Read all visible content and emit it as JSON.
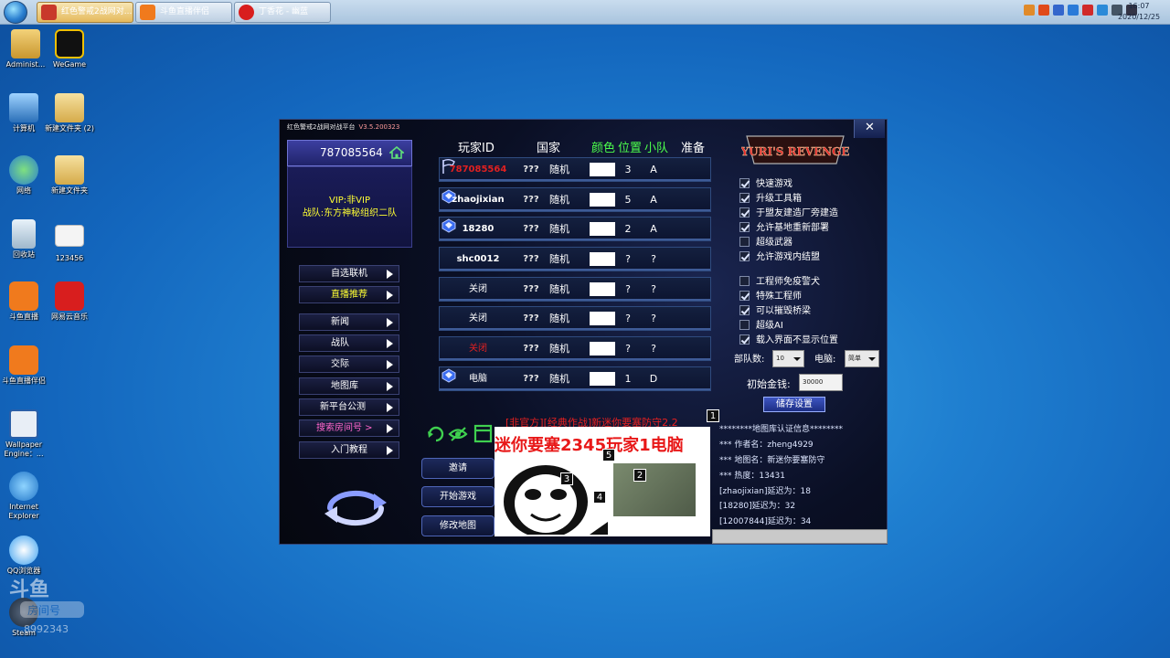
{
  "taskbar": {
    "tasks": [
      {
        "label": "红色警戒2战网对...",
        "active": true
      },
      {
        "label": "斗鱼直播伴侣",
        "active": false
      },
      {
        "label": "丁香花 - 幽蓝",
        "active": false
      }
    ],
    "clock_time": "16:07",
    "clock_date": "2020/12/25"
  },
  "desktop": {
    "icons": [
      {
        "label": "Administ...",
        "name": "administrator-folder-icon"
      },
      {
        "label": "WeGame",
        "name": "wegame-icon"
      },
      {
        "label": "计算机",
        "name": "computer-icon"
      },
      {
        "label": "新建文件夹 (2)",
        "name": "folder-icon"
      },
      {
        "label": "网络",
        "name": "network-icon"
      },
      {
        "label": "新建文件夹",
        "name": "folder-icon"
      },
      {
        "label": "回收站",
        "name": "recycle-bin-icon"
      },
      {
        "label": "123456",
        "name": "file-icon"
      },
      {
        "label": "斗鱼直播",
        "name": "douyu-icon"
      },
      {
        "label": "网易云音乐",
        "name": "netease-music-icon"
      },
      {
        "label": "斗鱼直播伴侣",
        "name": "douyu-companion-icon"
      },
      {
        "label": "Wallpaper Engine：...",
        "name": "wallpaper-engine-icon"
      },
      {
        "label": "Internet Explorer",
        "name": "ie-icon"
      },
      {
        "label": "QQ浏览器",
        "name": "qq-browser-icon"
      },
      {
        "label": "Steam",
        "name": "steam-icon"
      }
    ]
  },
  "watermark": {
    "room_label": "房间号",
    "room_number": "8992343"
  },
  "app": {
    "title": "红色警戒2战网对战平台",
    "version": "V3.5.200323",
    "close": "✕",
    "user_id": "787085564",
    "vip_line": "VIP:非VIP",
    "team_line": "战队:东方神秘组织二队",
    "menu": [
      {
        "label": "自选联机",
        "color": "#ffffff"
      },
      {
        "label": "直播推荐",
        "color": "#ffff33"
      },
      {
        "label": "新闻",
        "color": "#ffffff"
      },
      {
        "label": "战队",
        "color": "#ffffff"
      },
      {
        "label": "交际",
        "color": "#ffffff"
      },
      {
        "label": "地图库",
        "color": "#ffffff"
      },
      {
        "label": "新平台公测",
        "color": "#ffffff"
      },
      {
        "label": "搜索房间号 >",
        "color": "#ff66cc"
      },
      {
        "label": "入门教程",
        "color": "#ffffff"
      }
    ],
    "headers": {
      "player_id": "玩家ID",
      "country": "国家",
      "color": "颜色",
      "position": "位置",
      "team": "小队",
      "ready": "准备"
    },
    "rows": [
      {
        "id": "787085564",
        "id_color": "red",
        "flag": "???",
        "country": "随机",
        "pos": "3",
        "team": "A",
        "ready": "flag"
      },
      {
        "id": "zhaojixian",
        "id_color": "white",
        "flag": "???",
        "country": "随机",
        "pos": "5",
        "team": "A",
        "ready": "gem"
      },
      {
        "id": "18280",
        "id_color": "white",
        "flag": "???",
        "country": "随机",
        "pos": "2",
        "team": "A",
        "ready": "gem"
      },
      {
        "id": "shc0012",
        "id_color": "white",
        "flag": "???",
        "country": "随机",
        "pos": "?",
        "team": "?",
        "ready": ""
      },
      {
        "id": "关闭",
        "id_color": "white",
        "flag": "???",
        "country": "随机",
        "pos": "?",
        "team": "?",
        "ready": ""
      },
      {
        "id": "关闭",
        "id_color": "white",
        "flag": "???",
        "country": "随机",
        "pos": "?",
        "team": "?",
        "ready": ""
      },
      {
        "id": "关闭",
        "id_color": "red",
        "flag": "???",
        "country": "随机",
        "pos": "?",
        "team": "?",
        "ready": ""
      },
      {
        "id": "电脑",
        "id_color": "white",
        "flag": "???",
        "country": "随机",
        "pos": "1",
        "team": "D",
        "ready": "gem"
      }
    ],
    "map_title": "[非官方][经典作战]新迷你要塞防守2.2",
    "map_banner": "迷你要塞2345玩家1电脑",
    "map_tags": [
      "1",
      "5",
      "3",
      "2",
      "4"
    ],
    "buttons": {
      "invite": "邀请",
      "start": "开始游戏",
      "modify_map": "修改地图"
    },
    "logo_text": "YURI'S REVENGE",
    "options_a": [
      {
        "label": "快速游戏",
        "checked": true
      },
      {
        "label": "升级工具箱",
        "checked": true
      },
      {
        "label": "于盟友建造厂旁建造",
        "checked": true
      },
      {
        "label": "允许基地重新部署",
        "checked": true
      },
      {
        "label": "超级武器",
        "checked": false
      },
      {
        "label": "允许游戏内结盟",
        "checked": true
      }
    ],
    "options_b": [
      {
        "label": "工程师免疫警犬",
        "checked": false
      },
      {
        "label": "特殊工程师",
        "checked": true
      },
      {
        "label": "可以摧毁桥梁",
        "checked": true
      },
      {
        "label": "超级AI",
        "checked": false
      },
      {
        "label": "载入界面不显示位置",
        "checked": true
      }
    ],
    "units_label": "部队数:",
    "units_value": "10",
    "ai_label": "电脑:",
    "ai_value": "简单",
    "money_label": "初始金钱:",
    "money_value": "30000",
    "save_label": "储存设置",
    "info_lines": [
      "********地图库认证信息********",
      "*** 作者名：zheng4929",
      "*** 地图名：新迷你要塞防守",
      "*** 热度：13431",
      "[zhaojixian]延迟为：18",
      "[18280]延迟为：32",
      "[12007844]延迟为：34"
    ]
  }
}
